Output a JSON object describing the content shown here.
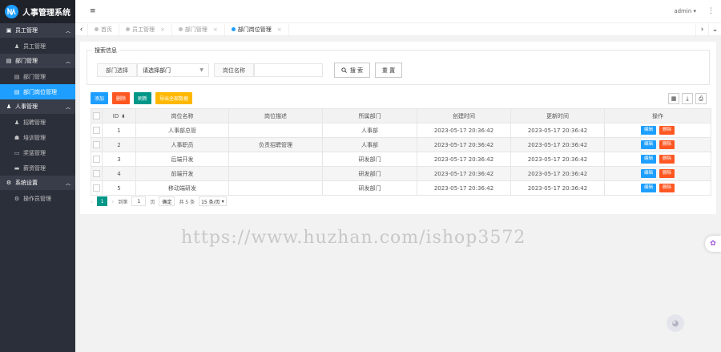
{
  "app": {
    "title": "人事管理系统",
    "logo_letter": "N"
  },
  "header": {
    "toggle_icon": "≡",
    "user": "admin ▾",
    "more": "⋮"
  },
  "sidebar": {
    "groups": [
      {
        "label": "员工管理",
        "icon": "user-icon",
        "glyph": "▣",
        "items": [
          {
            "label": "员工管理",
            "glyph": "♟",
            "active": false
          }
        ]
      },
      {
        "label": "部门管理",
        "icon": "building-icon",
        "glyph": "▤",
        "items": [
          {
            "label": "部门管理",
            "glyph": "▤",
            "active": false
          },
          {
            "label": "部门岗位管理",
            "glyph": "▤",
            "active": true
          }
        ]
      },
      {
        "label": "人事管理",
        "icon": "users-icon",
        "glyph": "♟",
        "items": [
          {
            "label": "招聘管理",
            "glyph": "♟",
            "active": false
          },
          {
            "label": "培训管理",
            "glyph": "☗",
            "active": false
          },
          {
            "label": "奖惩管理",
            "glyph": "▭",
            "active": false
          },
          {
            "label": "薪资管理",
            "glyph": "▬",
            "active": false
          }
        ]
      },
      {
        "label": "系统设置",
        "icon": "gear-icon",
        "glyph": "⚙",
        "items": [
          {
            "label": "操作员管理",
            "glyph": "⚙",
            "active": false
          }
        ]
      }
    ]
  },
  "tabs": {
    "prev": "‹",
    "next": "›",
    "dropdown": "⌄",
    "items": [
      {
        "label": "首页",
        "active": false
      },
      {
        "label": "员工管理",
        "active": false
      },
      {
        "label": "部门管理",
        "active": false
      },
      {
        "label": "部门岗位管理",
        "active": true
      }
    ]
  },
  "search": {
    "legend": "搜索信息",
    "dept_label": "部门选择",
    "dept_value": "请选择部门",
    "post_label": "岗位名称",
    "post_placeholder": "",
    "search_btn": "搜 索",
    "reset_btn": "重 置"
  },
  "toolbar": {
    "buttons": [
      {
        "label": "添加",
        "color": "#1e9fff"
      },
      {
        "label": "删除",
        "color": "#ff5722"
      },
      {
        "label": "刷新",
        "color": "#009688"
      },
      {
        "label": "导出全部数据",
        "color": "#ffb800"
      }
    ]
  },
  "table": {
    "headers": [
      "ID",
      "岗位名称",
      "岗位描述",
      "所属部门",
      "创建时间",
      "更新时间",
      "操作"
    ],
    "edit_label": "编辑",
    "delete_label": "删除",
    "rows": [
      {
        "id": "1",
        "name": "人事部总管",
        "desc": "",
        "dept": "人事部",
        "created": "2023-05-17 20:36:42",
        "updated": "2023-05-17 20:36:42"
      },
      {
        "id": "2",
        "name": "人事职员",
        "desc": "负责招聘管理",
        "dept": "人事部",
        "created": "2023-05-17 20:36:42",
        "updated": "2023-05-17 20:36:42"
      },
      {
        "id": "3",
        "name": "后端开发",
        "desc": "",
        "dept": "研发部门",
        "created": "2023-05-17 20:36:42",
        "updated": "2023-05-17 20:36:42"
      },
      {
        "id": "4",
        "name": "前端开发",
        "desc": "",
        "dept": "研发部门",
        "created": "2023-05-17 20:36:42",
        "updated": "2023-05-17 20:36:42"
      },
      {
        "id": "5",
        "name": "移动端研发",
        "desc": "",
        "dept": "研发部门",
        "created": "2023-05-17 20:36:42",
        "updated": "2023-05-17 20:36:42"
      }
    ]
  },
  "pager": {
    "current": "1",
    "goto_label": "到第",
    "page_value": "1",
    "page_unit": "页",
    "confirm": "确定",
    "total": "共 5 条",
    "per_page": "15 条/页"
  },
  "watermark": "https://www.huzhan.com/ishop3572"
}
